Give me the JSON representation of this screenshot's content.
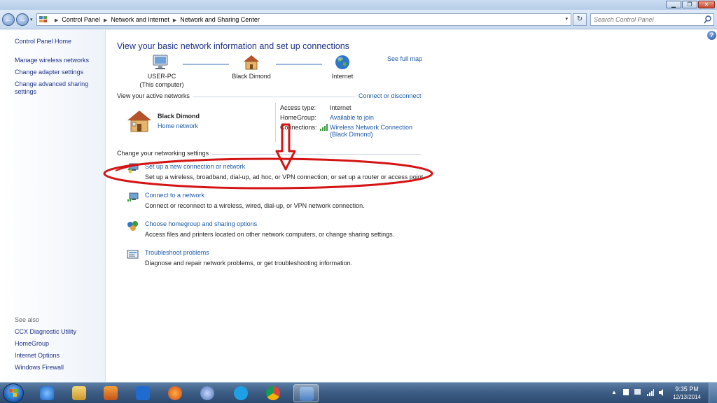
{
  "window": {
    "minimize_glyph": "▁",
    "maximize_glyph": "❐",
    "close_glyph": "✕"
  },
  "navbar": {
    "back_glyph": "←",
    "forward_glyph": "→",
    "recent_glyph": "▾",
    "breadcrumb": [
      "Control Panel",
      "Network and Internet",
      "Network and Sharing Center"
    ],
    "breadcrumb_sep": "▶",
    "dropdown_glyph": "▾",
    "refresh_glyph": "↻",
    "search_placeholder": "Search Control Panel"
  },
  "sidebar": {
    "items": [
      {
        "label": "Control Panel Home"
      },
      {
        "label": "Manage wireless networks"
      },
      {
        "label": "Change adapter settings"
      },
      {
        "label": "Change advanced sharing settings"
      }
    ],
    "advanced_sharing_line1": "Change advanced sharing",
    "advanced_sharing_line2": "settings",
    "see_also_label": "See also",
    "see_also": [
      {
        "label": "CCX Diagnostic Utility"
      },
      {
        "label": "HomeGroup"
      },
      {
        "label": "Internet Options"
      },
      {
        "label": "Windows Firewall"
      }
    ]
  },
  "main": {
    "help_glyph": "?",
    "title": "View your basic network information and set up connections",
    "see_full_map": "See full map",
    "map": {
      "computer_name": "USER-PC",
      "computer_sub": "(This computer)",
      "network_name": "Black Dimond",
      "internet": "Internet"
    },
    "active_networks_heading": "View your active networks",
    "connect_or_disconnect": "Connect or disconnect",
    "active_network": {
      "name": "Black Dimond",
      "type": "Home network",
      "access_type_label": "Access type:",
      "access_type_value": "Internet",
      "homegroup_label": "HomeGroup:",
      "homegroup_value": "Available to join",
      "connections_label": "Connections:",
      "connection_value_line1": "Wireless Network Connection",
      "connection_value_line2": "(Black Dimond)"
    },
    "settings_heading": "Change your networking settings",
    "tasks": [
      {
        "title": "Set up a new connection or network",
        "desc": "Set up a wireless, broadband, dial-up, ad hoc, or VPN connection; or set up a router or access point."
      },
      {
        "title": "Connect to a network",
        "desc": "Connect or reconnect to a wireless, wired, dial-up, or VPN network connection."
      },
      {
        "title": "Choose homegroup and sharing options",
        "desc": "Access files and printers located on other network computers, or change sharing settings."
      },
      {
        "title": "Troubleshoot problems",
        "desc": "Diagnose and repair network problems, or get troubleshooting information."
      }
    ]
  },
  "taskbar": {
    "tray_up_glyph": "▲",
    "time": "9:35 PM",
    "date": "12/13/2014"
  },
  "colors": {
    "link": "#1e5aa8",
    "sidebar_link": "#1e3287",
    "annotation_red": "#d41414"
  }
}
